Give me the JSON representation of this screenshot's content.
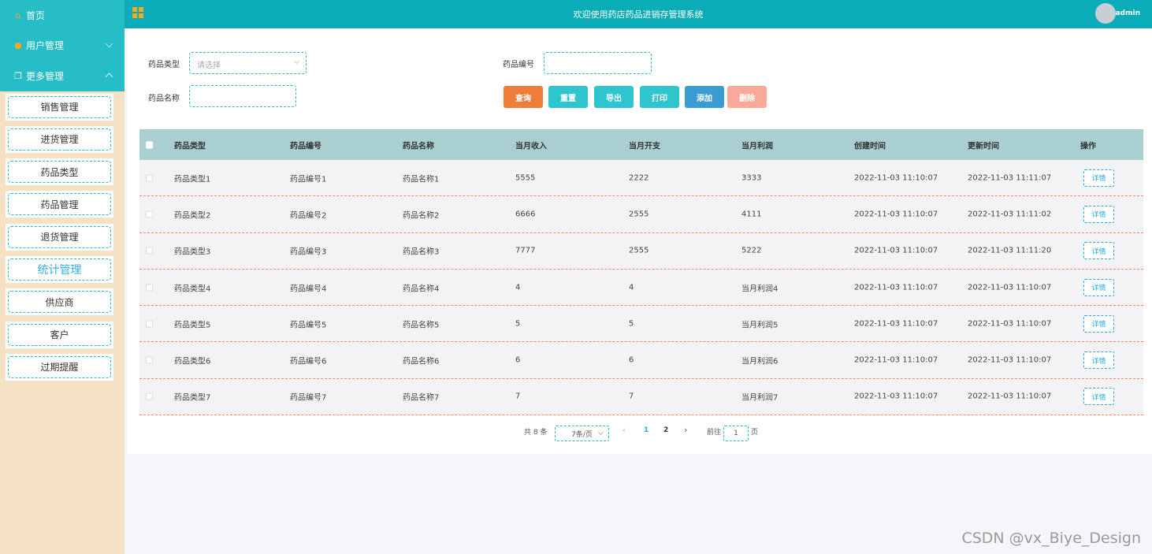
{
  "colors": {
    "teal": "#0aadb7",
    "sidebar_top": "#26bdc6",
    "sidebar_bg": "#f5e2c4",
    "query": "#f07c3a",
    "action": "#2ec5cf",
    "add": "#3b9bd3",
    "delete": "#f9a99a"
  },
  "sidebar": {
    "home_label": "首页",
    "user_mgmt_label": "用户管理",
    "more_mgmt_label": "更多管理",
    "items": [
      {
        "label": "销售管理"
      },
      {
        "label": "进货管理"
      },
      {
        "label": "药品类型"
      },
      {
        "label": "药品管理"
      },
      {
        "label": "退货管理"
      },
      {
        "label": "统计管理"
      },
      {
        "label": "供应商"
      },
      {
        "label": "客户"
      },
      {
        "label": "过期提醒"
      }
    ]
  },
  "header": {
    "title": "欢迎使用药店药品进销存管理系统",
    "user": "admin"
  },
  "filters": {
    "type_label": "药品类型",
    "type_placeholder": "请选择",
    "code_label": "药品编号",
    "name_label": "药品名称"
  },
  "buttons": {
    "query": "查询",
    "reset": "重置",
    "export": "导出",
    "print": "打印",
    "add": "添加",
    "delete": "删除"
  },
  "table": {
    "headers": [
      "药品类型",
      "药品编号",
      "药品名称",
      "当月收入",
      "当月开支",
      "当月利润",
      "创建时间",
      "更新时间",
      "操作"
    ],
    "detail_label": "详情",
    "rows": [
      [
        "药品类型1",
        "药品编号1",
        "药品名称1",
        "5555",
        "2222",
        "3333",
        "2022-11-03 11:10:07",
        "2022-11-03 11:11:07"
      ],
      [
        "药品类型2",
        "药品编号2",
        "药品名称2",
        "6666",
        "2555",
        "4111",
        "2022-11-03 11:10:07",
        "2022-11-03 11:11:02"
      ],
      [
        "药品类型3",
        "药品编号3",
        "药品名称3",
        "7777",
        "2555",
        "5222",
        "2022-11-03 11:10:07",
        "2022-11-03 11:11:20"
      ],
      [
        "药品类型4",
        "药品编号4",
        "药品名称4",
        "4",
        "4",
        "当月利润4",
        "2022-11-03 11:10:07",
        "2022-11-03 11:10:07"
      ],
      [
        "药品类型5",
        "药品编号5",
        "药品名称5",
        "5",
        "5",
        "当月利润5",
        "2022-11-03 11:10:07",
        "2022-11-03 11:10:07"
      ],
      [
        "药品类型6",
        "药品编号6",
        "药品名称6",
        "6",
        "6",
        "当月利润6",
        "2022-11-03 11:10:07",
        "2022-11-03 11:10:07"
      ],
      [
        "药品类型7",
        "药品编号7",
        "药品名称7",
        "7",
        "7",
        "当月利润7",
        "2022-11-03 11:10:07",
        "2022-11-03 11:10:07"
      ]
    ]
  },
  "pagination": {
    "total": "共 8 条",
    "page_size": "7条/页",
    "page1": "1",
    "page2": "2",
    "goto_label": "前往",
    "goto_value": "1",
    "page_unit": "页"
  },
  "watermark": "CSDN @vx_Biye_Design"
}
